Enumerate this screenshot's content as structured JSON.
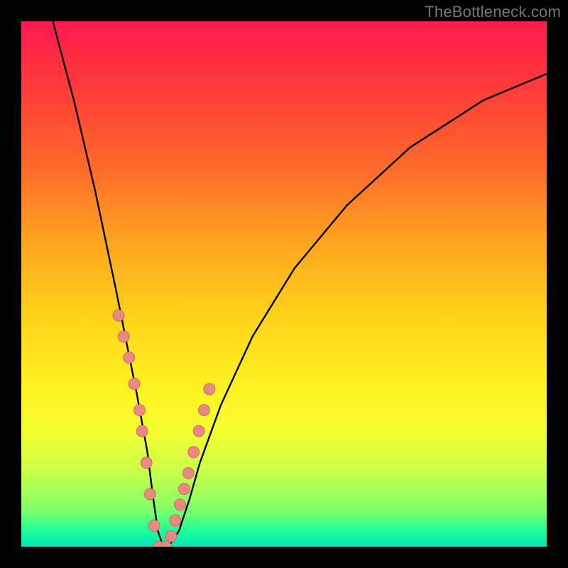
{
  "watermark": "TheBottleneck.com",
  "chart_data": {
    "type": "line",
    "title": "",
    "xlabel": "",
    "ylabel": "",
    "xlim": [
      0,
      100
    ],
    "ylim": [
      0,
      100
    ],
    "series": [
      {
        "name": "bottleneck-curve",
        "x": [
          6,
          10,
          14,
          18,
          20,
          22,
          24,
          25,
          26,
          27,
          28,
          30,
          32,
          34,
          38,
          44,
          52,
          62,
          74,
          88,
          100
        ],
        "values": [
          100,
          85,
          68,
          49,
          39,
          29,
          18,
          10,
          3,
          0,
          0,
          3,
          9,
          16,
          27,
          40,
          53,
          65,
          76,
          85,
          90
        ]
      }
    ],
    "markers": {
      "name": "sample-points",
      "x": [
        18.5,
        19.5,
        20.5,
        21.5,
        22.5,
        23.0,
        23.8,
        24.5,
        25.3,
        26.2,
        27.5,
        28.5,
        29.3,
        30.2,
        31.0,
        31.8,
        32.8,
        33.8,
        34.8,
        35.8
      ],
      "values": [
        44,
        40,
        36,
        31,
        26,
        22,
        16,
        10,
        4,
        0,
        0,
        2,
        5,
        8,
        11,
        14,
        18,
        22,
        26,
        30
      ]
    },
    "colors": {
      "curve": "#000000",
      "marker_fill": "#e98a82",
      "marker_stroke": "#d26a62"
    }
  }
}
